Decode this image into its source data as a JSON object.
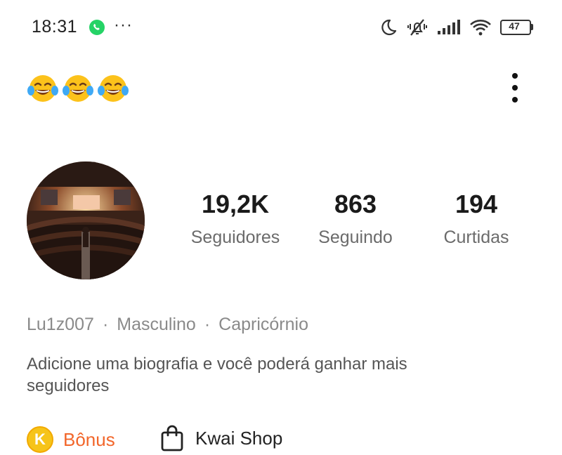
{
  "status_bar": {
    "time": "18:31",
    "more": "···",
    "battery": "47",
    "icons": [
      "whatsapp-icon",
      "moon-icon",
      "vibrate-off-icon",
      "signal-icon",
      "wifi-icon",
      "battery-icon"
    ]
  },
  "header": {
    "emojis": [
      "😂",
      "😂",
      "😂"
    ],
    "menu_icon": "kebab-menu-icon"
  },
  "profile": {
    "stats": [
      {
        "value": "19,2K",
        "label": "Seguidores"
      },
      {
        "value": "863",
        "label": "Seguindo"
      },
      {
        "value": "194",
        "label": "Curtidas"
      }
    ],
    "username": "Lu1z007",
    "separator": "·",
    "gender": "Masculino",
    "sign": "Capricórnio",
    "bio": "Adicione uma biografia e você poderá ganhar mais seguidores"
  },
  "actions": {
    "bonus_label": "Bônus",
    "bonus_coin": "K",
    "shop_label": "Kwai Shop"
  },
  "colors": {
    "bonus_orange": "#f2662a",
    "coin_yellow": "#f6c419",
    "whatsapp_green": "#25d366"
  }
}
